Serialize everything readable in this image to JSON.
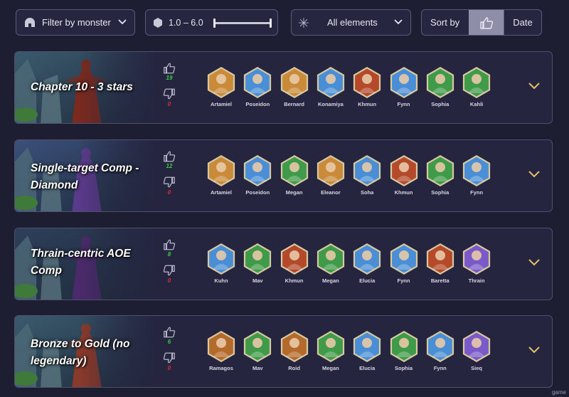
{
  "filters": {
    "monster_label": "Filter by monster",
    "stars_range": "1.0  – 6.0",
    "element_label": "All elements",
    "sort_label": "Sort by",
    "sort_thumb_icon": "thumbs-up-icon",
    "sort_date_label": "Date",
    "stars_min": 1.0,
    "stars_max": 6.0
  },
  "comps": [
    {
      "title": "Chapter 10 - 3 stars",
      "upvotes": "19",
      "downvotes": "0",
      "bg": [
        "#3b5a6e",
        "#7a2a1e"
      ],
      "heroes": [
        {
          "name": "Artamiel",
          "color": "#c98a3a"
        },
        {
          "name": "Poseidon",
          "color": "#4a8fd6"
        },
        {
          "name": "Bernard",
          "color": "#c98a3a"
        },
        {
          "name": "Konamiya",
          "color": "#4a8fd6"
        },
        {
          "name": "Khmun",
          "color": "#b44a2a"
        },
        {
          "name": "Fynn",
          "color": "#4a8fd6"
        },
        {
          "name": "Sophia",
          "color": "#3f9a4a"
        },
        {
          "name": "Kahli",
          "color": "#3f9a4a"
        }
      ]
    },
    {
      "title": "Single-target Comp - Diamond",
      "upvotes": "12",
      "downvotes": "0",
      "bg": [
        "#3b4f7a",
        "#5a3a8a"
      ],
      "heroes": [
        {
          "name": "Artamiel",
          "color": "#c98a3a"
        },
        {
          "name": "Poseidon",
          "color": "#4a8fd6"
        },
        {
          "name": "Megan",
          "color": "#3f9a4a"
        },
        {
          "name": "Eleanor",
          "color": "#c98a3a"
        },
        {
          "name": "Soha",
          "color": "#4a8fd6"
        },
        {
          "name": "Khmun",
          "color": "#b44a2a"
        },
        {
          "name": "Sophia",
          "color": "#3f9a4a"
        },
        {
          "name": "Fynn",
          "color": "#4a8fd6"
        }
      ]
    },
    {
      "title": "Thrain-centric AOE Comp",
      "upvotes": "8",
      "downvotes": "0",
      "bg": [
        "#2e3f5a",
        "#4a2a6a"
      ],
      "heroes": [
        {
          "name": "Kuhn",
          "color": "#4a8fd6"
        },
        {
          "name": "Mav",
          "color": "#3f9a4a"
        },
        {
          "name": "Khmun",
          "color": "#b44a2a"
        },
        {
          "name": "Megan",
          "color": "#3f9a4a"
        },
        {
          "name": "Elucia",
          "color": "#4a8fd6"
        },
        {
          "name": "Fynn",
          "color": "#4a8fd6"
        },
        {
          "name": "Baretta",
          "color": "#b44a2a"
        },
        {
          "name": "Thrain",
          "color": "#7a5ac8"
        }
      ]
    },
    {
      "title": "Bronze to Gold (no legendary)",
      "upvotes": "6",
      "downvotes": "0",
      "bg": [
        "#3b5a6e",
        "#8a3a2a"
      ],
      "heroes": [
        {
          "name": "Ramagos",
          "color": "#b46a2a"
        },
        {
          "name": "Mav",
          "color": "#3f9a4a"
        },
        {
          "name": "Roid",
          "color": "#b46a2a"
        },
        {
          "name": "Megan",
          "color": "#3f9a4a"
        },
        {
          "name": "Elucia",
          "color": "#4a8fd6"
        },
        {
          "name": "Sophia",
          "color": "#3f9a4a"
        },
        {
          "name": "Fynn",
          "color": "#4a8fd6"
        },
        {
          "name": "Sieq",
          "color": "#7a5ac8"
        }
      ]
    }
  ],
  "watermark": "game"
}
